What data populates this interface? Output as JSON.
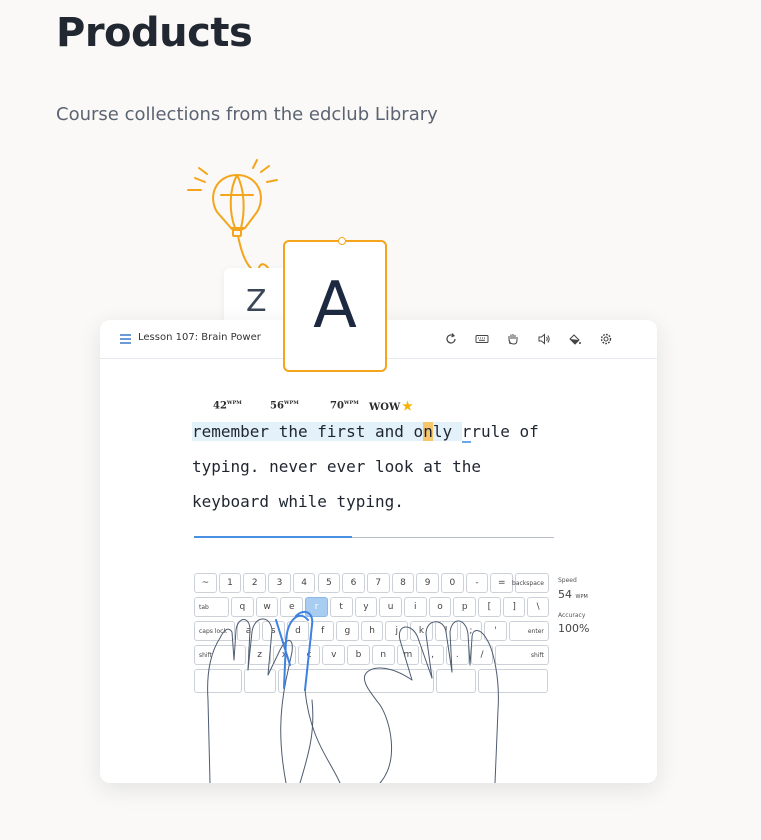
{
  "page": {
    "title": "Products",
    "subtitle": "Course collections from the edclub Library"
  },
  "cards": {
    "back_letter": "Z",
    "front_letter": "A"
  },
  "colors": {
    "accent_orange": "#f4a51c",
    "accent_blue": "#4a90e2",
    "highlight": "#e3f1fb"
  },
  "app": {
    "menu_icon": "hamburger-icon",
    "lesson_title": "Lesson 107: Brain Power",
    "toolbar_icons": [
      "restart-icon",
      "keyboard-icon",
      "hand-icon",
      "sound-icon",
      "theme-icon",
      "settings-icon"
    ],
    "milestones": [
      {
        "value": "42",
        "unit": "WPM"
      },
      {
        "value": "56",
        "unit": "WPM"
      },
      {
        "value": "70",
        "unit": "WPM"
      }
    ],
    "milestone_final": "WOW",
    "lines": {
      "l1_typed": "remember the first and o",
      "l1_cursor": "n",
      "l1_rest_typed": "ly",
      "l1_space": " ",
      "l1_rest": "rule of",
      "l2": "typing. never ever look at the",
      "l3": "keyboard while typing."
    },
    "progress": 0.44,
    "keyboard": {
      "row1": [
        "~",
        "1",
        "2",
        "3",
        "4",
        "5",
        "6",
        "7",
        "8",
        "9",
        "0",
        "-",
        "=",
        "backspace"
      ],
      "row2": [
        "tab",
        "q",
        "w",
        "e",
        "r",
        "t",
        "y",
        "u",
        "i",
        "o",
        "p",
        "[",
        "]",
        "\\"
      ],
      "row3": [
        "caps lock",
        "a",
        "s",
        "d",
        "f",
        "g",
        "h",
        "j",
        "k",
        "l",
        ";",
        "'",
        "enter"
      ],
      "row4": [
        "shift",
        "z",
        "x",
        "c",
        "v",
        "b",
        "n",
        "m",
        ",",
        ".",
        "/",
        "shift"
      ],
      "active_key": "r"
    },
    "stats": {
      "speed_label": "Speed",
      "speed_value": "54",
      "speed_unit": "WPM",
      "accuracy_label": "Accuracy",
      "accuracy_value": "100%"
    }
  }
}
